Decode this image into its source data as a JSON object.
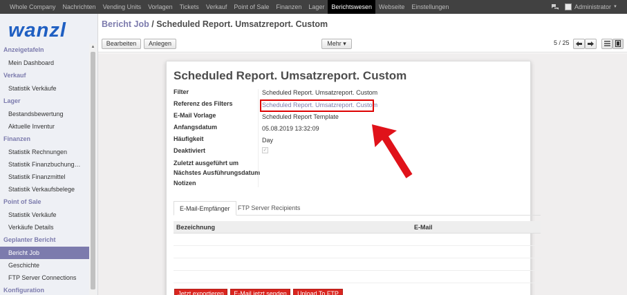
{
  "topbar": {
    "menu": [
      "Whole Company",
      "Nachrichten",
      "Vending Units",
      "Vorlagen",
      "Tickets",
      "Verkauf",
      "Point of Sale",
      "Finanzen",
      "Lager",
      "Berichtswesen",
      "Webseite",
      "Einstellungen"
    ],
    "active": "Berichtswesen",
    "user": "Administrator"
  },
  "logo": {
    "text": "wanzl"
  },
  "sidebar": {
    "sections": [
      {
        "title": "Anzeigetafeln",
        "items": [
          "Mein Dashboard"
        ]
      },
      {
        "title": "Verkauf",
        "items": [
          "Statistik Verkäufe"
        ]
      },
      {
        "title": "Lager",
        "items": [
          "Bestandsbewertung",
          "Aktuelle Inventur"
        ]
      },
      {
        "title": "Finanzen",
        "items": [
          "Statistik Rechnungen",
          "Statistik Finanzbuchung…",
          "Statistik Finanzmittel",
          "Statistik Verkaufsbelege"
        ]
      },
      {
        "title": "Point of Sale",
        "items": [
          "Statistik Verkäufe",
          "Verkäufe Details"
        ]
      },
      {
        "title": "Geplanter Bericht",
        "items": [
          "Bericht Job",
          "Geschichte",
          "FTP Server Connections"
        ]
      },
      {
        "title": "Konfiguration",
        "items": []
      }
    ],
    "active_item": "Bericht Job"
  },
  "breadcrumb": {
    "parent": "Bericht Job",
    "separator": " / ",
    "current": "Scheduled Report. Umsatzreport. Custom"
  },
  "toolbar": {
    "edit": "Bearbeiten",
    "create": "Anlegen",
    "more": "Mehr ▾",
    "pager": "5 / 25"
  },
  "form": {
    "title": "Scheduled Report. Umsatzreport. Custom",
    "labels": {
      "filter": "Filter",
      "ref": "Referenz des Filters",
      "email_template": "E-Mail Vorlage",
      "start": "Anfangsdatum",
      "freq": "Häufigkeit",
      "inactive": "Deaktiviert",
      "last_run": "Zuletzt ausgeführt um",
      "next_run": "Nächstes Ausführungsdatum",
      "notes": "Notizen"
    },
    "values": {
      "filter": "Scheduled Report. Umsatzreport. Custom",
      "ref": "Scheduled Report. Umsatzreport. Custom",
      "email_template": "Scheduled Report Template",
      "start": "05.08.2019 13:32:09",
      "freq": "Day"
    },
    "tabs": [
      "E-Mail-Empfänger",
      "FTP Server Recipients"
    ],
    "table": {
      "headers": [
        "Bezeichnung",
        "E-Mail"
      ]
    },
    "actions": [
      "Jetzt exportieren",
      "E-Mail jetzt senden",
      "Upload To FTP"
    ]
  },
  "colors": {
    "accent": "#7c7bad",
    "topbar": "#414141",
    "action": "#d9251f",
    "highlight": "#dd0000"
  }
}
